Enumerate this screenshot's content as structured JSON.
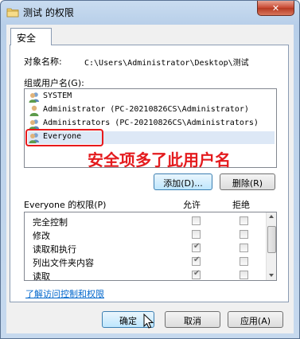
{
  "window": {
    "title": "测试 的权限",
    "close_glyph": "✕"
  },
  "tab": {
    "label": "安全"
  },
  "object": {
    "label": "对象名称:",
    "value": "C:\\Users\\Administrator\\Desktop\\测试"
  },
  "group_label": "组或用户名(G):",
  "users": [
    {
      "name": "SYSTEM",
      "icon": "user-group-icon"
    },
    {
      "name": "Administrator (PC-20210826CS\\Administrator)",
      "icon": "user-icon"
    },
    {
      "name": "Administrators (PC-20210826CS\\Administrators)",
      "icon": "user-group-icon"
    },
    {
      "name": "Everyone",
      "icon": "user-group-icon",
      "selected": true
    }
  ],
  "annotation": "安全项多了此用户名",
  "buttons": {
    "add": "添加(D)...",
    "remove": "删除(R)",
    "ok": "确定",
    "cancel": "取消",
    "apply": "应用(A)"
  },
  "permissions": {
    "header": "Everyone 的权限(P)",
    "allow": "允许",
    "deny": "拒绝",
    "rows": [
      {
        "name": "完全控制",
        "allow": false,
        "deny": false
      },
      {
        "name": "修改",
        "allow": false,
        "deny": false
      },
      {
        "name": "读取和执行",
        "allow": true,
        "deny": false
      },
      {
        "name": "列出文件夹内容",
        "allow": true,
        "deny": false
      },
      {
        "name": "读取",
        "allow": true,
        "deny": false
      }
    ]
  },
  "link": "了解访问控制和权限"
}
